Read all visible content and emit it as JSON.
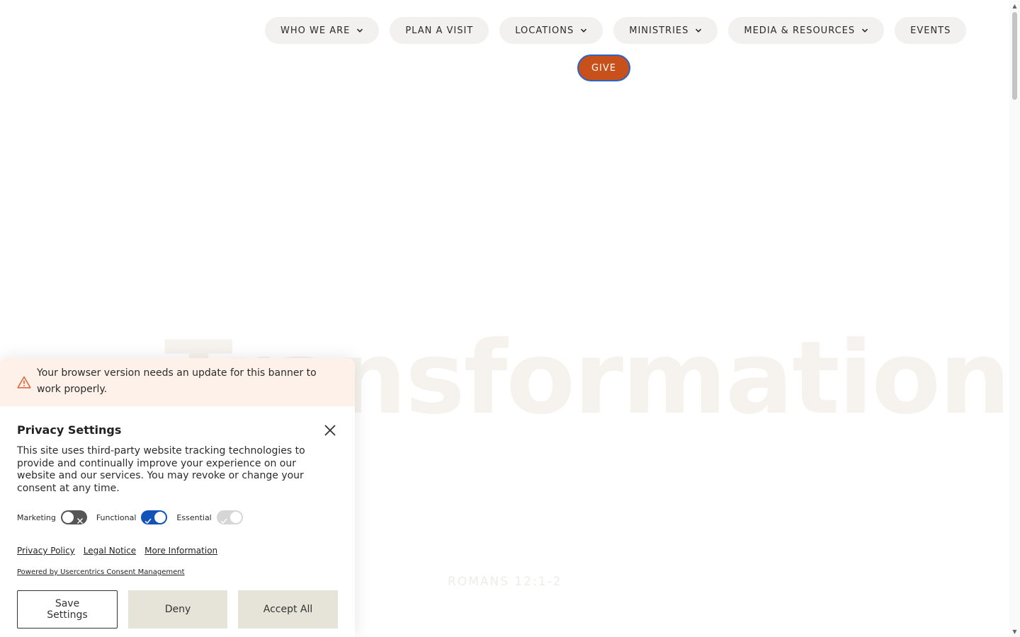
{
  "nav": {
    "items": [
      {
        "label": "WHO WE ARE",
        "dropdown": true
      },
      {
        "label": "PLAN A VISIT",
        "dropdown": false
      },
      {
        "label": "LOCATIONS",
        "dropdown": true
      },
      {
        "label": "MINISTRIES",
        "dropdown": true
      },
      {
        "label": "MEDIA & RESOURCES",
        "dropdown": true
      },
      {
        "label": "EVENTS",
        "dropdown": false
      }
    ],
    "give_label": "GIVE"
  },
  "hero": {
    "word": "Transformation",
    "scripture": "ROMANS 12:1-2"
  },
  "privacy": {
    "warning": "Your browser version needs an update for this banner to work properly.",
    "title": "Privacy Settings",
    "description": "This site uses third-party website tracking technologies to provide and continually improve your experience on our website and our services. You may revoke or change your consent at any time.",
    "toggles": [
      {
        "label": "Marketing",
        "state": "off"
      },
      {
        "label": "Functional",
        "state": "on"
      },
      {
        "label": "Essential",
        "state": "on-disabled"
      }
    ],
    "links": [
      "Privacy Policy",
      "Legal Notice",
      "More Information"
    ],
    "powered_by": "Powered by Usercentrics Consent Management",
    "buttons": {
      "save": "Save Settings",
      "deny": "Deny",
      "accept": "Accept All"
    }
  },
  "colors": {
    "give_bg": "#c8501b",
    "toggle_on": "#1352b8",
    "warning_bg": "#fdf1ea",
    "button_bg": "#e6e4d8"
  }
}
